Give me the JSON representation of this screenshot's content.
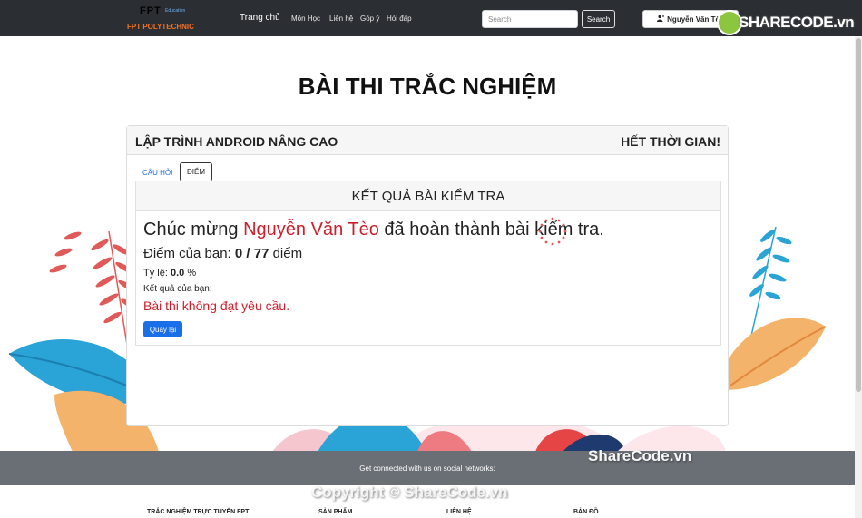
{
  "navbar": {
    "logo_fpt": "FPT",
    "logo_edu": "Education",
    "logo_poly": "FPT POLYTECHNIC",
    "home": "Trang chủ",
    "links": [
      "Môn Học",
      "Liên hệ",
      "Góp ý",
      "Hỏi đáp"
    ],
    "search_placeholder": "Search",
    "search_button": "Search",
    "user_name": "Nguyễn Văn Tèo",
    "watermark_logo": "SHARECODE.vn"
  },
  "page": {
    "title": "BÀI THI TRẮC NGHIỆM"
  },
  "exam": {
    "course": "LẬP TRÌNH ANDROID NÂNG CAO",
    "status": "HẾT THỜI GIAN!",
    "tabs": [
      "CÂU HỎI",
      "ĐIỂM"
    ],
    "result_heading": "KẾT QUẢ BÀI KIỂM TRA",
    "congrats_prefix": "Chúc mừng",
    "student_name": "Nguyễn Văn Tèo",
    "congrats_suffix": "đã hoàn thành bài kiểm tra.",
    "score_label": "Điểm của bạn:",
    "score_value": "0 / 77",
    "score_unit": "điểm",
    "ratio_label": "Tỷ lệ:",
    "ratio_value": "0.0",
    "ratio_unit": "%",
    "result_label": "Kết quả của bạn:",
    "result_text": "Bài thi không đạt yêu cầu.",
    "back_button": "Quay lại"
  },
  "footer": {
    "social": "Get connected with us on social networks:",
    "columns": [
      "TRẮC NGHIỆM TRỰC TUYẾN FPT",
      "SẢN PHẨM",
      "LIÊN HỆ",
      "BẢN ĐỒ"
    ]
  },
  "watermarks": [
    "ShareCode.vn",
    "Copyright © ShareCode.vn"
  ],
  "colors": {
    "navbar": "#2b2f33",
    "accent_red": "#cc1f2b",
    "primary": "#1a6fe8",
    "footer": "#6a6f75"
  }
}
